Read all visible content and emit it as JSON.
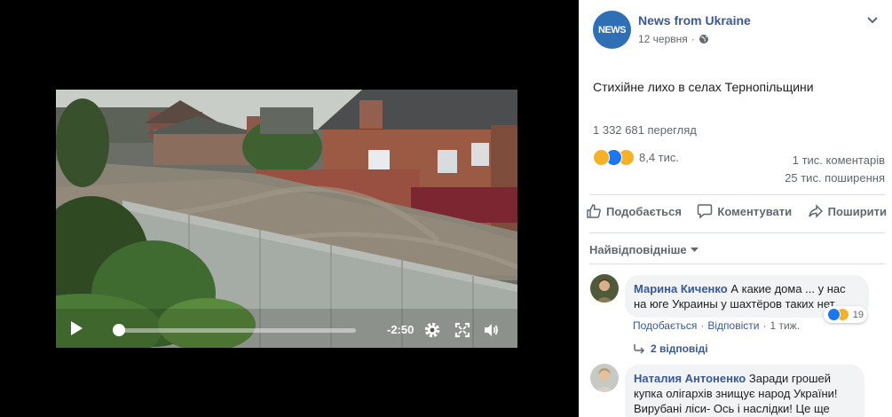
{
  "player": {
    "time_remaining": "-2:50",
    "progress": 0.02
  },
  "post": {
    "page_name": "News from Ukraine",
    "avatar_text": "NEWS",
    "date": "12 червня",
    "separator": "·",
    "text": "Стихійне лихо в селах Тернопільщини",
    "views": "1 332 681 перегляд",
    "reaction_count": "8,4 тис.",
    "comments_count": "1 тис. коментарів",
    "shares_count": "25 тис. поширення"
  },
  "actions": {
    "like": "Подобається",
    "comment": "Коментувати",
    "share": "Поширити"
  },
  "sort_label": "Найвідповідніше",
  "comments": [
    {
      "author": "Марина Киченко",
      "text_line1": "А какие дома ... у нас",
      "text_line2": "на юге Украины у шахтёров таких нет....",
      "like_label": "Подобається",
      "reply_label": "Відповісти",
      "time": "1 тиж.",
      "reaction_count": "19",
      "replies_label": "2 відповіді"
    },
    {
      "author": "Наталия Антоненко",
      "text_line1": "Заради грошей",
      "text_line2": "купка олігархів знищує народ України!",
      "text_line3": "Вирубані ліси- Ось і наслідки! Це ще"
    }
  ],
  "colors": {
    "link": "#385898",
    "secondary_text": "#606770",
    "like_blue": "#1877f2",
    "reaction_yellow": "#f7b125"
  }
}
